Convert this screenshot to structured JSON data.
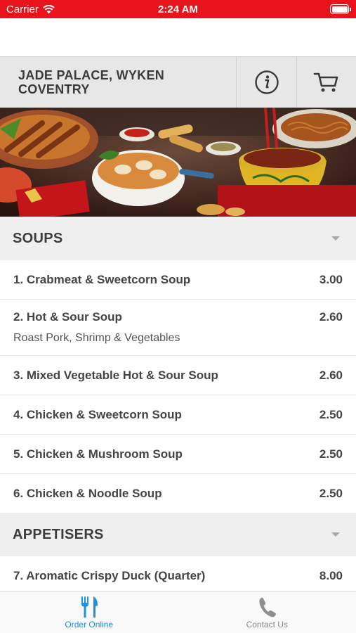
{
  "status_bar": {
    "carrier": "Carrier",
    "time": "2:24 AM"
  },
  "header": {
    "title_line1": "JADE PALACE, WYKEN",
    "title_line2": "COVENTRY",
    "info_icon": "info-icon",
    "cart_icon": "cart-icon"
  },
  "colors": {
    "status_bar": "#e8131b",
    "active_tab": "#1a8fe3",
    "inactive_tab": "#888888"
  },
  "sections": [
    {
      "name": "SOUPS",
      "items": [
        {
          "name": "1. Crabmeat & Sweetcorn Soup",
          "price": "3.00"
        },
        {
          "name": "2. Hot & Sour Soup",
          "price": "2.60",
          "description": "Roast Pork, Shrimp & Vegetables"
        },
        {
          "name": "3. Mixed Vegetable Hot & Sour Soup",
          "price": "2.60"
        },
        {
          "name": "4. Chicken & Sweetcorn Soup",
          "price": "2.50"
        },
        {
          "name": "5. Chicken & Mushroom Soup",
          "price": "2.50"
        },
        {
          "name": "6. Chicken & Noodle Soup",
          "price": "2.50"
        }
      ]
    },
    {
      "name": "APPETISERS",
      "items": [
        {
          "name": "7. Aromatic Crispy Duck (Quarter)",
          "price": "8.00"
        }
      ]
    }
  ],
  "tabbar": {
    "order_label": "Order Online",
    "order_icon": "fork-knife-icon",
    "contact_label": "Contact Us",
    "contact_icon": "phone-icon"
  }
}
